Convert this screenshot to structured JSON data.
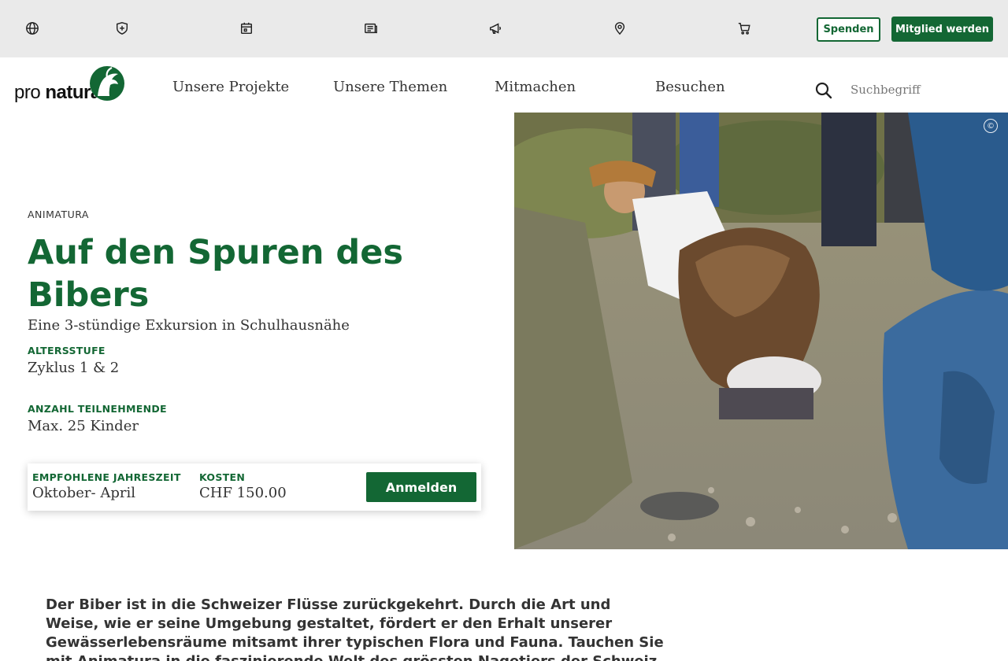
{
  "topbar": {
    "icons": [
      "globe-icon",
      "shield-cross-icon",
      "calendar-icon",
      "news-icon",
      "megaphone-icon",
      "location-pin-icon",
      "cart-icon"
    ],
    "donate_label": "Spenden",
    "member_label": "Mitglied werden"
  },
  "nav": {
    "logo_text_a": "pro",
    "logo_text_b": "natura",
    "items": [
      "Unsere Projekte",
      "Unsere Themen",
      "Mitmachen",
      "Besuchen"
    ],
    "search_placeholder": "Suchbegriff"
  },
  "hero": {
    "kicker": "ANIMATURA",
    "title": "Auf den Spuren des Bibers",
    "subtitle": "Eine 3-stündige Exkursion in Schulhausnähe",
    "age_label": "ALTERSSTUFE",
    "age_value": "Zyklus 1 & 2",
    "participants_label": "ANZAHL TEILNEHMENDE",
    "participants_value": "Max. 25 Kinder",
    "season_label": "EMPFOHLENE JAHRESZEIT",
    "season_value": "Oktober- April",
    "cost_label": "KOSTEN",
    "cost_value": "CHF 150.00",
    "register_label": "Anmelden",
    "copyright_symbol": "©"
  },
  "lead": "Der Biber ist in die Schweizer Flüsse zurückgekehrt. Durch die Art und Weise, wie er seine Umgebung gestaltet, fördert er den Erhalt unserer Gewässerlebensräume mitsamt ihrer typischen Flora und Fauna. Tauchen Sie mit Animatura in die faszinierende Welt des grössten Nagetiers der Schweiz ein!",
  "colors": {
    "brand_green": "#136734",
    "topbar_bg": "#eaeaea"
  }
}
